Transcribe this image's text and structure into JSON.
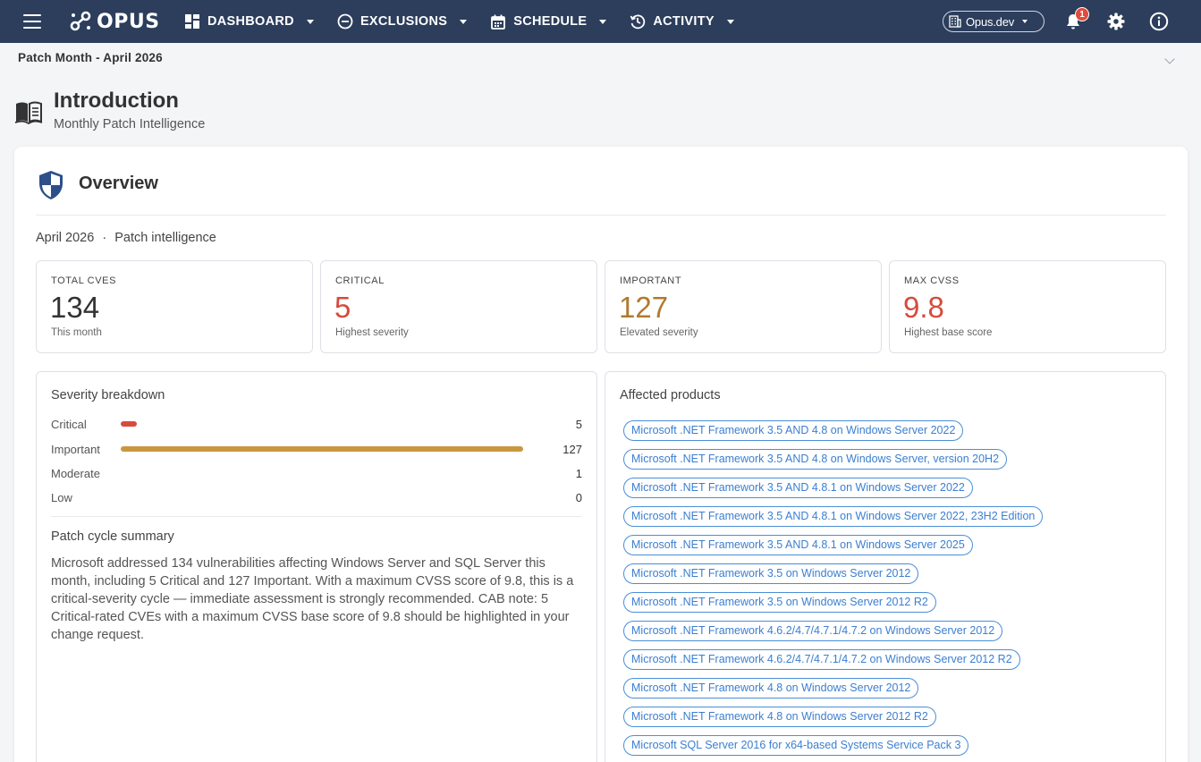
{
  "nav": {
    "logo_text": "OPUS",
    "items": [
      {
        "label": "DASHBOARD"
      },
      {
        "label": "EXCLUSIONS"
      },
      {
        "label": "SCHEDULE"
      },
      {
        "label": "ACTIVITY"
      }
    ],
    "tenant": "Opus.dev",
    "notification_count": "1"
  },
  "section": {
    "title": "Patch Month - April 2026"
  },
  "intro": {
    "title": "Introduction",
    "subtitle": "Monthly Patch Intelligence"
  },
  "overview": {
    "title": "Overview",
    "period": "April 2026",
    "period_sep": "·",
    "period_label": "Patch intelligence",
    "stats": [
      {
        "label": "TOTAL CVES",
        "value": "134",
        "sub": "This month",
        "color": "#333333"
      },
      {
        "label": "CRITICAL",
        "value": "5",
        "sub": "Highest severity",
        "color": "#d64b3c"
      },
      {
        "label": "IMPORTANT",
        "value": "127",
        "sub": "Elevated severity",
        "color": "#b07a2c"
      },
      {
        "label": "MAX CVSS",
        "value": "9.8",
        "sub": "Highest base score",
        "color": "#d64b3c"
      }
    ]
  },
  "severity": {
    "title": "Severity breakdown",
    "max": 127,
    "rows": [
      {
        "label": "Critical",
        "count": "5",
        "value": 5,
        "color": "#d64b3c"
      },
      {
        "label": "Important",
        "count": "127",
        "value": 127,
        "color": "#c9973f"
      },
      {
        "label": "Moderate",
        "count": "1",
        "value": 0,
        "color": "#c9973f"
      },
      {
        "label": "Low",
        "count": "0",
        "value": 0,
        "color": "#c9973f"
      }
    ]
  },
  "summary": {
    "title": "Patch cycle summary",
    "text": "Microsoft addressed 134 vulnerabilities affecting Windows Server and SQL Server this month, including 5 Critical and 127 Important. With a maximum CVSS score of 9.8, this is a critical-severity cycle — immediate assessment is strongly recommended. CAB note: 5 Critical-rated CVEs with a maximum CVSS base score of 9.8 should be highlighted in your change request."
  },
  "products": {
    "title": "Affected products",
    "items": [
      "Microsoft .NET Framework 3.5 AND 4.8 on Windows Server 2022",
      "Microsoft .NET Framework 3.5 AND 4.8 on Windows Server, version 20H2",
      "Microsoft .NET Framework 3.5 AND 4.8.1 on Windows Server 2022",
      "Microsoft .NET Framework 3.5 AND 4.8.1 on Windows Server 2022, 23H2 Edition",
      "Microsoft .NET Framework 3.5 AND 4.8.1 on Windows Server 2025",
      "Microsoft .NET Framework 3.5 on Windows Server 2012",
      "Microsoft .NET Framework 3.5 on Windows Server 2012 R2",
      "Microsoft .NET Framework 4.6.2/4.7/4.7.1/4.7.2 on Windows Server 2012",
      "Microsoft .NET Framework 4.6.2/4.7/4.7.1/4.7.2 on Windows Server 2012 R2",
      "Microsoft .NET Framework 4.8 on Windows Server 2012",
      "Microsoft .NET Framework 4.8 on Windows Server 2012 R2",
      "Microsoft SQL Server 2016 for x64-based Systems Service Pack 3"
    ]
  },
  "icons": {
    "menu": "hamburger-menu-icon",
    "dashboard": "grid-icon",
    "exclusions": "minus-circle-icon",
    "schedule": "calendar-icon",
    "activity": "history-icon",
    "tenant": "building-icon",
    "notifications": "bell-icon",
    "settings": "gear-icon",
    "info": "info-icon",
    "intro": "book-icon",
    "overview": "shield-icon"
  }
}
